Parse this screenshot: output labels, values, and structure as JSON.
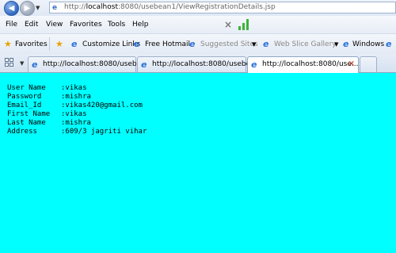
{
  "address_bar": {
    "scheme": "http://",
    "host": "localhost",
    "rest": ":8080/usebean1/ViewRegistrationDetails.jsp"
  },
  "menu": {
    "items": [
      "File",
      "Edit",
      "View",
      "Favorites",
      "Tools",
      "Help"
    ]
  },
  "favorites_bar": {
    "label": "Favorites",
    "links": [
      {
        "label": "Customize Links",
        "dimmed": false
      },
      {
        "label": "Free Hotmail",
        "dimmed": false
      },
      {
        "label": "Suggested Sites",
        "dimmed": true
      },
      {
        "label": "Web Slice Gallery",
        "dimmed": true
      },
      {
        "label": "Windows",
        "dimmed": false
      }
    ]
  },
  "tabs": [
    {
      "label": "http://localhost:8080/usebe...",
      "active": false
    },
    {
      "label": "http://localhost:8080/usebe...",
      "active": false
    },
    {
      "label": "http://localhost:8080/use...",
      "active": true
    }
  ],
  "details": [
    {
      "label": "User Name",
      "value": ":vikas"
    },
    {
      "label": "Password",
      "value": ":mishra"
    },
    {
      "label": "Email_Id",
      "value": ":vikas420@gmail.com"
    },
    {
      "label": "First Name",
      "value": ":vikas"
    },
    {
      "label": "Last Name",
      "value": ":mishra"
    },
    {
      "label": "Address",
      "value": ":609/3 jagriti vihar"
    }
  ],
  "colors": {
    "content_background": "#00ffff",
    "ie_blue": "#2b72d8",
    "favorites_star": "#e6a400"
  }
}
